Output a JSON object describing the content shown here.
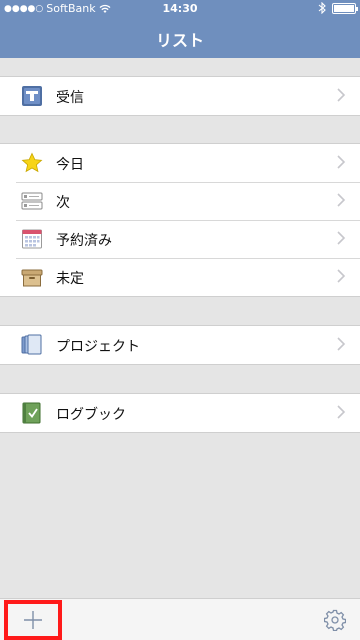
{
  "status_bar": {
    "carrier": "SoftBank",
    "time": "14:30"
  },
  "nav": {
    "title": "リスト"
  },
  "groups": [
    {
      "items": [
        {
          "label": "受信",
          "icon": "inbox-icon"
        }
      ]
    },
    {
      "items": [
        {
          "label": "今日",
          "icon": "star-icon"
        },
        {
          "label": "次",
          "icon": "next-list-icon"
        },
        {
          "label": "予約済み",
          "icon": "calendar-icon"
        },
        {
          "label": "未定",
          "icon": "box-icon"
        }
      ]
    },
    {
      "items": [
        {
          "label": "プロジェクト",
          "icon": "projects-icon"
        }
      ]
    },
    {
      "items": [
        {
          "label": "ログブック",
          "icon": "logbook-icon"
        }
      ]
    }
  ],
  "toolbar": {
    "add_icon": "plus-icon",
    "settings_icon": "gear-icon"
  },
  "colors": {
    "nav_bar": "#6f8fbe",
    "background": "#e5e5e5",
    "highlight": "#ff1a1a",
    "chevron": "#c7c7cc"
  }
}
